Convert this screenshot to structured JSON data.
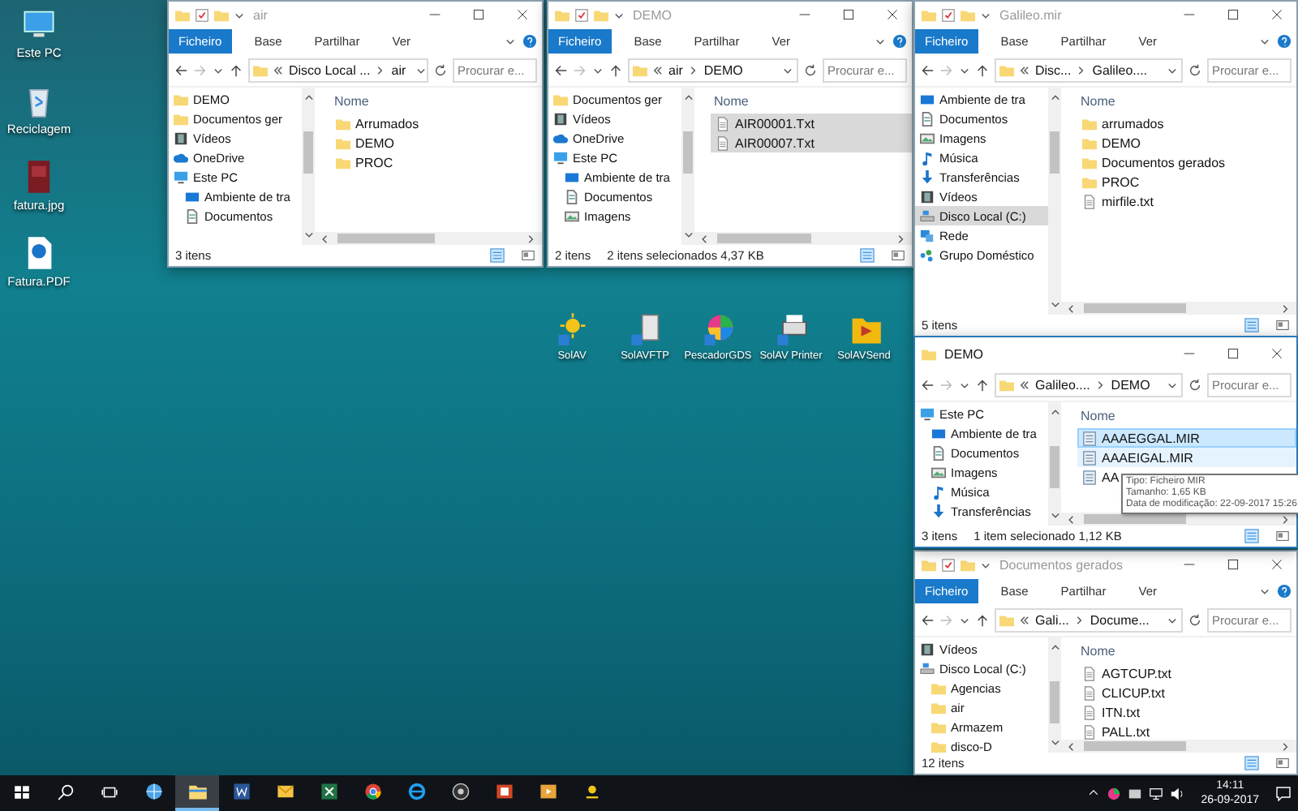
{
  "desktop_icons": [
    {
      "label": "Este PC",
      "kind": "pc"
    },
    {
      "label": "Reciclagem",
      "kind": "recycle"
    },
    {
      "label": "fatura.jpg",
      "kind": "image"
    },
    {
      "label": "Fatura.PDF",
      "kind": "pdf"
    }
  ],
  "app_icons": [
    {
      "label": "SolAV",
      "kind": "solav"
    },
    {
      "label": "SolAVFTP",
      "kind": "ftp"
    },
    {
      "label": "PescadorGDS",
      "kind": "pescador"
    },
    {
      "label": "SolAV Printer",
      "kind": "printer"
    },
    {
      "label": "SolAVSend",
      "kind": "send"
    }
  ],
  "windows": [
    {
      "title": "air",
      "active": false,
      "ribbon": [
        {
          "label": "Ficheiro",
          "kind": "file"
        },
        {
          "label": "Base",
          "kind": "tab"
        },
        {
          "label": "Partilhar",
          "kind": "tab"
        },
        {
          "label": "Ver",
          "kind": "tab"
        }
      ],
      "crumbs": [
        "Disco Local ...",
        "air"
      ],
      "placeholder": "Procurar e...",
      "nav": [
        {
          "label": "DEMO",
          "kind": "folder",
          "selected": false
        },
        {
          "label": "Documentos ger",
          "kind": "folder",
          "selected": false
        },
        {
          "label": "Vídeos",
          "kind": "video",
          "selected": false
        },
        {
          "label": "OneDrive",
          "kind": "cloud",
          "selected": false
        },
        {
          "label": "Este PC",
          "kind": "pc",
          "selected": false,
          "children": [
            {
              "label": "Ambiente de tra",
              "kind": "desktop",
              "selected": false
            },
            {
              "label": "Documentos",
              "kind": "doc",
              "selected": false
            }
          ]
        }
      ],
      "column": "Nome",
      "files": [
        {
          "name": "Arrumados",
          "kind": "folder",
          "selected": false
        },
        {
          "name": "DEMO",
          "kind": "folder",
          "selected": false
        },
        {
          "name": "PROC",
          "kind": "folder",
          "selected": false
        }
      ],
      "count": "3 itens"
    },
    {
      "title": "DEMO",
      "active": false,
      "ribbon": [
        {
          "label": "Ficheiro",
          "kind": "file"
        },
        {
          "label": "Base",
          "kind": "tab"
        },
        {
          "label": "Partilhar",
          "kind": "tab"
        },
        {
          "label": "Ver",
          "kind": "tab"
        }
      ],
      "crumbs": [
        "air",
        "DEMO"
      ],
      "placeholder": "Procurar e...",
      "nav": [
        {
          "label": "Documentos ger",
          "kind": "folder",
          "selected": false
        },
        {
          "label": "Vídeos",
          "kind": "video",
          "selected": false
        },
        {
          "label": "OneDrive",
          "kind": "cloud",
          "selected": false
        },
        {
          "label": "Este PC",
          "kind": "pc",
          "selected": false,
          "children": [
            {
              "label": "Ambiente de tra",
              "kind": "desktop",
              "selected": false
            },
            {
              "label": "Documentos",
              "kind": "doc",
              "selected": false
            },
            {
              "label": "Imagens",
              "kind": "pictures",
              "selected": false
            }
          ]
        }
      ],
      "column": "Nome",
      "files": [
        {
          "name": "AIR00001.Txt",
          "kind": "txt",
          "selected": true
        },
        {
          "name": "AIR00007.Txt",
          "kind": "txt",
          "selected": true
        }
      ],
      "count": "2 itens",
      "selection": "2 itens selecionados 4,37 KB"
    },
    {
      "title": "Galileo.mir",
      "active": false,
      "ribbon": [
        {
          "label": "Ficheiro",
          "kind": "file"
        },
        {
          "label": "Base",
          "kind": "tab"
        },
        {
          "label": "Partilhar",
          "kind": "tab"
        },
        {
          "label": "Ver",
          "kind": "tab"
        }
      ],
      "crumbs": [
        "Disc...",
        "Galileo...."
      ],
      "placeholder": "Procurar e...",
      "nav": [
        {
          "label": "Ambiente de tra",
          "kind": "desktop",
          "selected": false
        },
        {
          "label": "Documentos",
          "kind": "doc",
          "selected": false
        },
        {
          "label": "Imagens",
          "kind": "pictures",
          "selected": false
        },
        {
          "label": "Música",
          "kind": "music",
          "selected": false
        },
        {
          "label": "Transferências",
          "kind": "download",
          "selected": false
        },
        {
          "label": "Vídeos",
          "kind": "video",
          "selected": false
        },
        {
          "label": "Disco Local (C:)",
          "kind": "drive",
          "selected": true
        },
        {
          "label": "Rede",
          "kind": "network",
          "selected": false
        },
        {
          "label": "Grupo Doméstico",
          "kind": "homegroup",
          "selected": false
        }
      ],
      "column": "Nome",
      "files": [
        {
          "name": "arrumados",
          "kind": "folder",
          "selected": false
        },
        {
          "name": "DEMO",
          "kind": "folder",
          "selected": false
        },
        {
          "name": "Documentos gerados",
          "kind": "folder",
          "selected": false
        },
        {
          "name": "PROC",
          "kind": "folder",
          "selected": false
        },
        {
          "name": "mirfile.txt",
          "kind": "txt",
          "selected": false
        }
      ],
      "count": "5 itens"
    },
    {
      "title": "DEMO",
      "active": true,
      "crumbs": [
        "Galileo....",
        "DEMO"
      ],
      "placeholder": "Procurar e...",
      "nav": [
        {
          "label": "Este PC",
          "kind": "pc",
          "selected": false,
          "children": [
            {
              "label": "Ambiente de tra",
              "kind": "desktop",
              "selected": false
            },
            {
              "label": "Documentos",
              "kind": "doc",
              "selected": false
            },
            {
              "label": "Imagens",
              "kind": "pictures",
              "selected": false
            },
            {
              "label": "Música",
              "kind": "music",
              "selected": false
            },
            {
              "label": "Transferências",
              "kind": "download",
              "selected": false
            }
          ]
        }
      ],
      "column": "Nome",
      "files": [
        {
          "name": "AAAEGGAL.MIR",
          "kind": "mir",
          "selected": true,
          "hovered": false
        },
        {
          "name": "AAAEIGAL.MIR",
          "kind": "mir",
          "selected": false,
          "hovered": true
        },
        {
          "name": "AA",
          "kind": "mir",
          "selected": false,
          "hovered": false
        }
      ],
      "tooltip": [
        "Tipo: Ficheiro MIR",
        "Tamanho: 1,65 KB",
        "Data de modificação: 22-09-2017 15:26"
      ],
      "count": "3 itens",
      "selection": "1 item selecionado 1,12 KB"
    },
    {
      "title": "Documentos gerados",
      "active": false,
      "ribbon": [
        {
          "label": "Ficheiro",
          "kind": "file"
        },
        {
          "label": "Base",
          "kind": "tab"
        },
        {
          "label": "Partilhar",
          "kind": "tab"
        },
        {
          "label": "Ver",
          "kind": "tab"
        }
      ],
      "crumbs": [
        "Gali...",
        "Docume..."
      ],
      "placeholder": "Procurar e...",
      "nav": [
        {
          "label": "Vídeos",
          "kind": "video",
          "selected": false
        },
        {
          "label": "Disco Local (C:)",
          "kind": "drive",
          "selected": false,
          "children": [
            {
              "label": "Agencias",
              "kind": "folder",
              "selected": false
            },
            {
              "label": "air",
              "kind": "folder",
              "selected": false
            },
            {
              "label": "Armazem",
              "kind": "folder",
              "selected": false
            },
            {
              "label": "disco-D",
              "kind": "folder",
              "selected": false
            }
          ]
        }
      ],
      "column": "Nome",
      "files": [
        {
          "name": "AGTCUP.txt",
          "kind": "txt",
          "selected": false
        },
        {
          "name": "CLICUP.txt",
          "kind": "txt",
          "selected": false
        },
        {
          "name": "ITN.txt",
          "kind": "txt",
          "selected": false
        },
        {
          "name": "PALL.txt",
          "kind": "txt",
          "selected": false
        }
      ],
      "count": "12 itens"
    }
  ],
  "taskbar": {
    "apps": [
      {
        "kind": "network-app",
        "selected": false
      },
      {
        "kind": "explorer",
        "selected": true
      },
      {
        "kind": "word",
        "selected": false
      },
      {
        "kind": "mail",
        "selected": false
      },
      {
        "kind": "excel",
        "selected": false
      },
      {
        "kind": "chrome",
        "selected": false
      },
      {
        "kind": "ie",
        "selected": false
      },
      {
        "kind": "recorder",
        "selected": false
      },
      {
        "kind": "ppt",
        "selected": false
      },
      {
        "kind": "media",
        "selected": false
      },
      {
        "kind": "solav",
        "selected": false
      }
    ],
    "time": "14:11",
    "date": "26-09-2017"
  }
}
